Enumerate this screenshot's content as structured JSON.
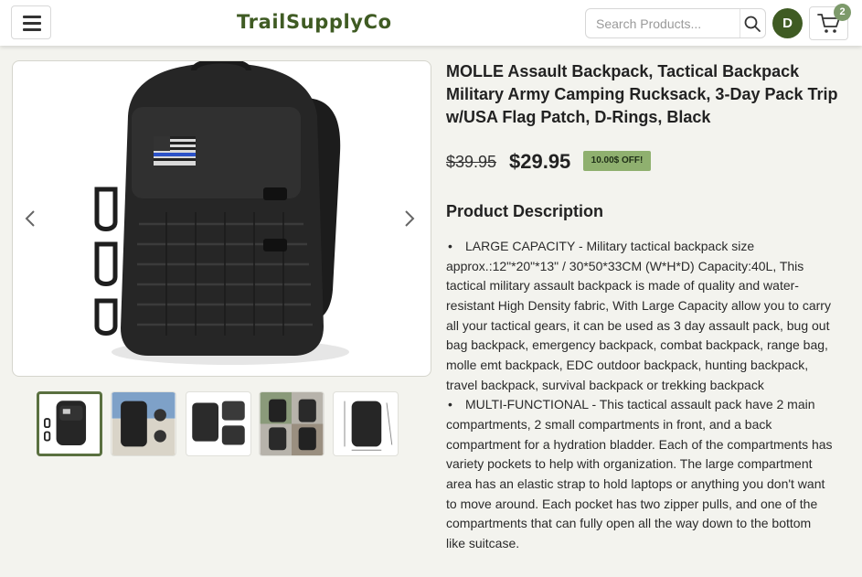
{
  "header": {
    "logo": "TrailSupplyCo",
    "search_placeholder": "Search Products...",
    "avatar_initial": "D",
    "cart_count": "2"
  },
  "product": {
    "title": "MOLLE Assault Backpack, Tactical Backpack Military Army Camping Rucksack, 3-Day Pack Trip w/USA Flag Patch, D-Rings, Black",
    "old_price": "$39.95",
    "price": "$29.95",
    "discount_badge": "10.00$ OFF!",
    "description_heading": "Product Description",
    "description_items": [
      "LARGE CAPACITY - Military tactical backpack size approx.:12\"*20\"*13\" / 30*50*33CM (W*H*D) Capacity:40L, This tactical military assault backpack is made of quality and water-resistant High Density fabric, With Large Capacity allow you to carry all your tactical gears, it can be used as 3 day assault pack, bug out bag backpack, emergency backpack, combat backpack, range bag, molle emt backpack, EDC outdoor backpack, hunting backpack, travel backpack, survival backpack or trekking backpack",
      "MULTI-FUNCTIONAL - This tactical assault pack have 2 main compartments, 2 small compartments in front, and a back compartment for a hydration bladder. Each of the compartments has variety pockets to help with organization. The large compartment area has an elastic strap to hold laptops or anything you don't want to move around. Each pocket has two zipper pulls, and one of the compartments that can fully open all the way down to the bottom like suitcase."
    ]
  },
  "gallery": {
    "thumbnail_count": 5,
    "active_index": 0
  },
  "colors": {
    "brand": "#3f5b23",
    "badge": "#8fb06f",
    "background": "#f3f3ee"
  }
}
